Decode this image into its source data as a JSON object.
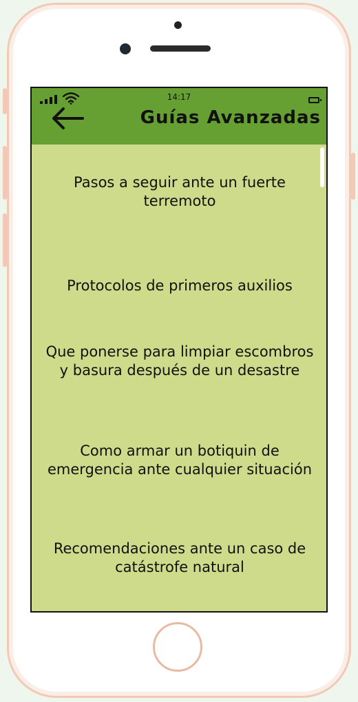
{
  "status_bar": {
    "time": "14:17"
  },
  "header": {
    "title": "Guías Avanzadas",
    "back_icon": "arrow-left-icon"
  },
  "guides": [
    {
      "label": "Pasos a seguir ante un fuerte terremoto"
    },
    {
      "label": "Protocolos de primeros auxilios"
    },
    {
      "label": "Que ponerse para limpiar escombros y basura después de un desastre"
    },
    {
      "label": "Como armar un botiquin de emergencia ante cualquier situación"
    },
    {
      "label": "Recomendaciones ante un caso de catástrofe natural"
    }
  ],
  "colors": {
    "header_bg": "#66a032",
    "content_bg": "#cddb8b",
    "frame": "#f2c9b5"
  }
}
